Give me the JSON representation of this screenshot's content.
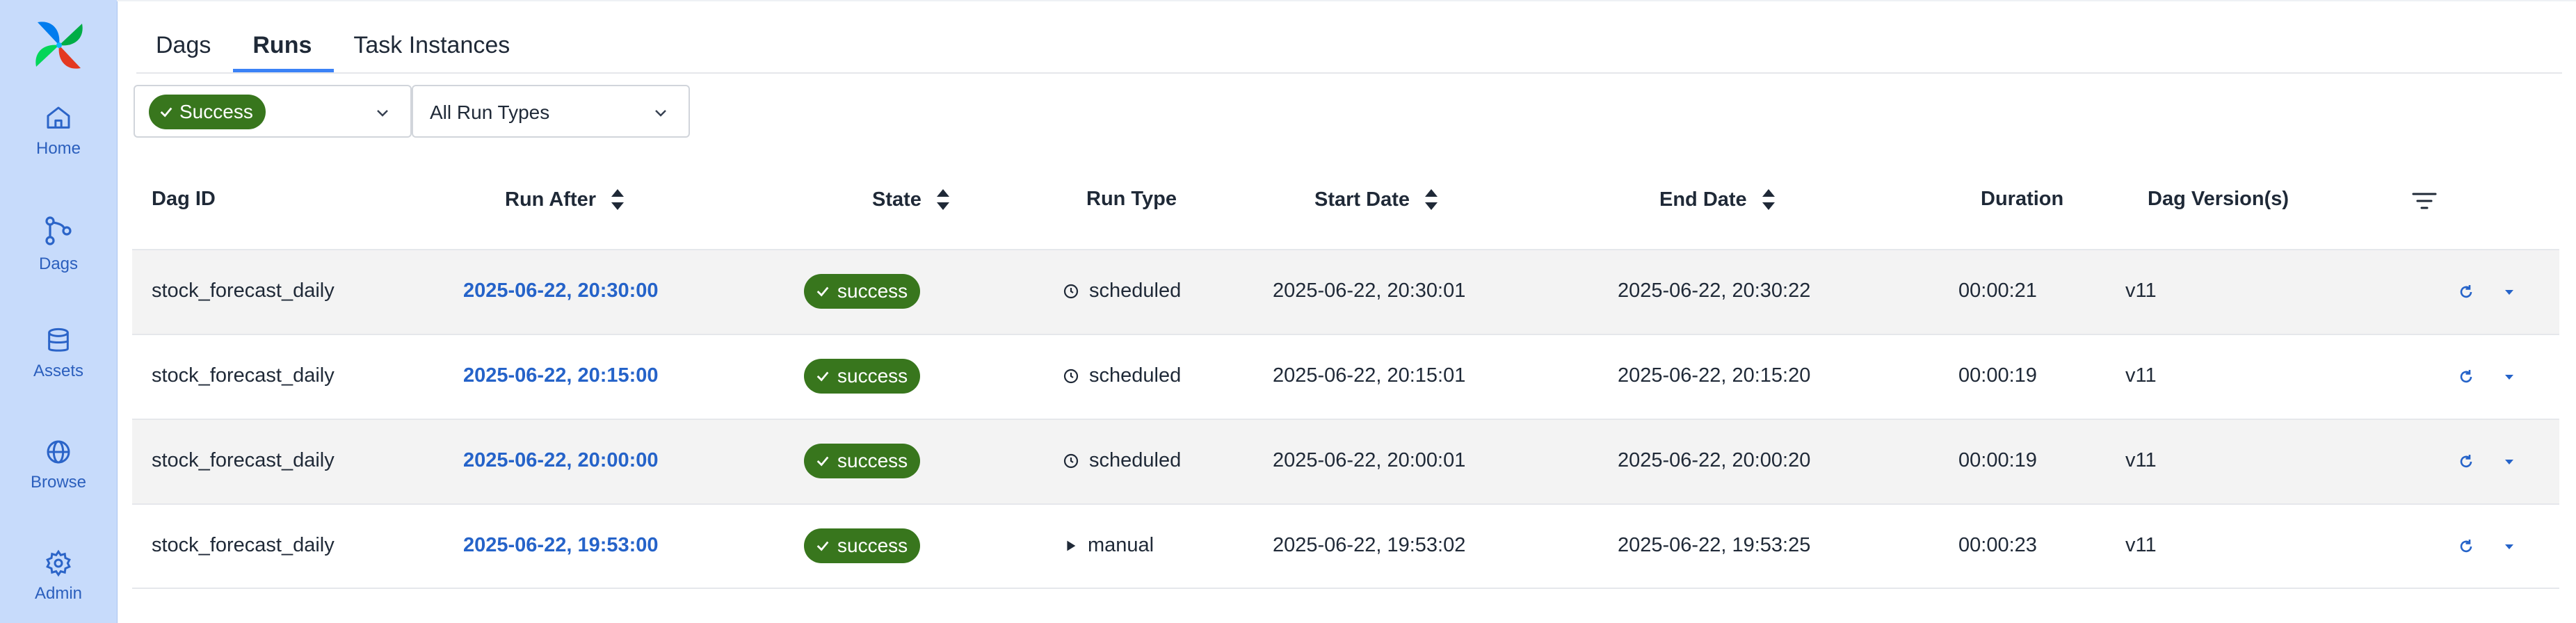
{
  "sidebar": {
    "items": [
      {
        "label": "Home",
        "icon": "home-icon"
      },
      {
        "label": "Dags",
        "icon": "dag-icon"
      },
      {
        "label": "Assets",
        "icon": "database-icon"
      },
      {
        "label": "Browse",
        "icon": "globe-icon"
      },
      {
        "label": "Admin",
        "icon": "gear-icon"
      }
    ]
  },
  "tabs": [
    {
      "label": "Dags"
    },
    {
      "label": "Runs",
      "active": true
    },
    {
      "label": "Task Instances"
    }
  ],
  "filters": {
    "state": {
      "value": "Success"
    },
    "run_type": {
      "value": "All Run Types"
    }
  },
  "table": {
    "columns": [
      "Dag ID",
      "Run After",
      "State",
      "Run Type",
      "Start Date",
      "End Date",
      "Duration",
      "Dag Version(s)"
    ],
    "rows": [
      {
        "dag_id": "stock_forecast_daily",
        "run_after": "2025-06-22, 20:30:00",
        "state": "success",
        "run_type": "scheduled",
        "start_date": "2025-06-22, 20:30:01",
        "end_date": "2025-06-22, 20:30:22",
        "duration": "00:00:21",
        "version": "v11"
      },
      {
        "dag_id": "stock_forecast_daily",
        "run_after": "2025-06-22, 20:15:00",
        "state": "success",
        "run_type": "scheduled",
        "start_date": "2025-06-22, 20:15:01",
        "end_date": "2025-06-22, 20:15:20",
        "duration": "00:00:19",
        "version": "v11"
      },
      {
        "dag_id": "stock_forecast_daily",
        "run_after": "2025-06-22, 20:00:00",
        "state": "success",
        "run_type": "scheduled",
        "start_date": "2025-06-22, 20:00:01",
        "end_date": "2025-06-22, 20:00:20",
        "duration": "00:00:19",
        "version": "v11"
      },
      {
        "dag_id": "stock_forecast_daily",
        "run_after": "2025-06-22, 19:53:00",
        "state": "success",
        "run_type": "manual",
        "start_date": "2025-06-22, 19:53:02",
        "end_date": "2025-06-22, 19:53:25",
        "duration": "00:00:23",
        "version": "v11"
      }
    ]
  },
  "colors": {
    "sidebar_bg": "#c7dbfb",
    "accent": "#3b82f6",
    "success": "#38761d",
    "link": "#2563c9"
  }
}
